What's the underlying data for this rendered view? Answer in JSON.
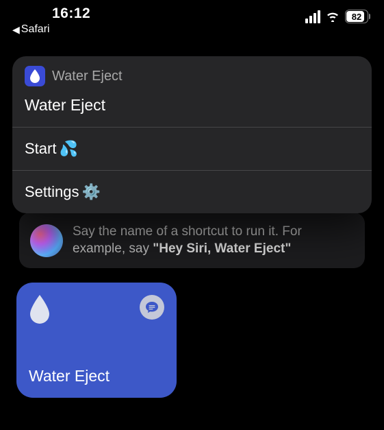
{
  "statusBar": {
    "time": "16:12",
    "backLabel": "Safari",
    "battery": "82"
  },
  "contextMenu": {
    "appName": "Water Eject",
    "title": "Water Eject",
    "rows": [
      {
        "label": "Start ",
        "emoji": "💦"
      },
      {
        "label": "Settings ",
        "emoji": "⚙️"
      }
    ]
  },
  "siri": {
    "prefix": "Say the name of a shortcut to run it. For example, say ",
    "quote": "\"Hey Siri, Water Eject\""
  },
  "shortcut": {
    "label": "Water Eject"
  }
}
